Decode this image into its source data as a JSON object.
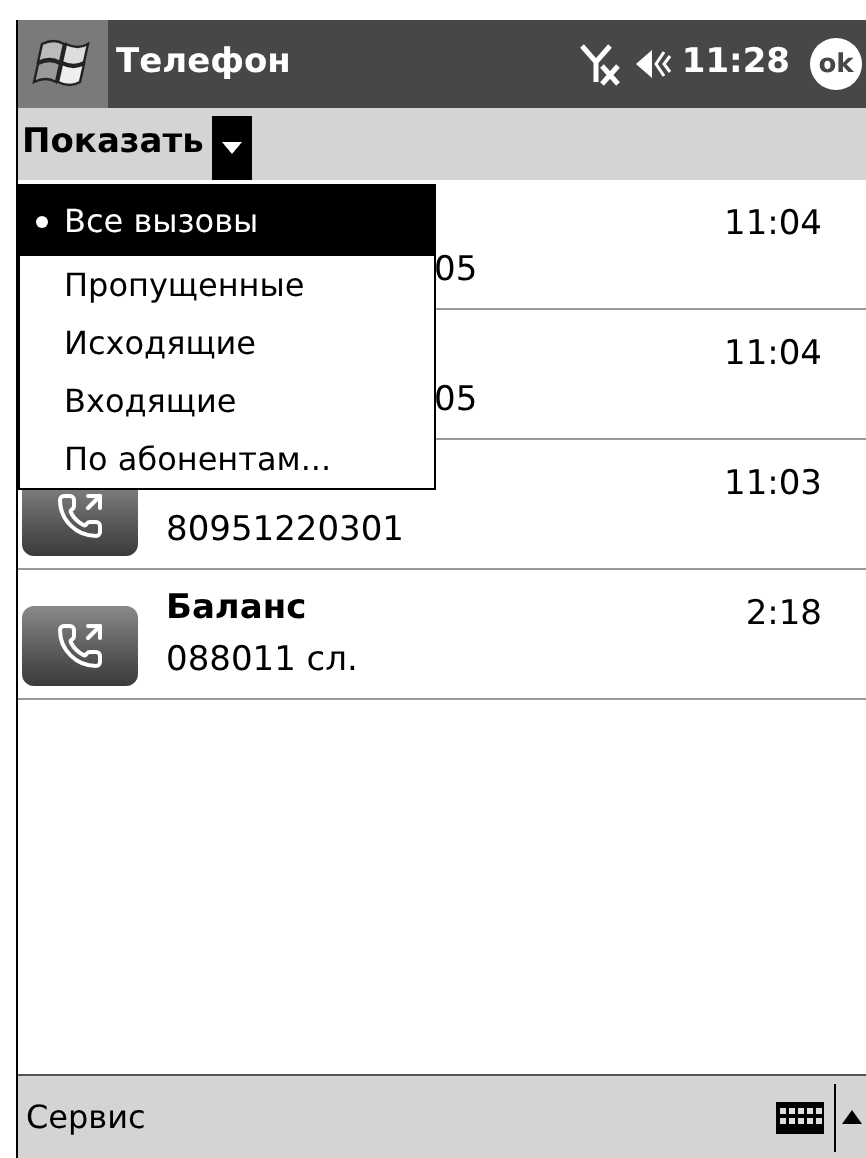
{
  "title_bar": {
    "title": "Телефон",
    "time": "11:28",
    "ok_button": "ok"
  },
  "filter_bar": {
    "label": "Показать"
  },
  "filter_menu": [
    {
      "label": "Все вызовы",
      "selected": true
    },
    {
      "label": "Пропущенные",
      "selected": false
    },
    {
      "label": "Исходящие",
      "selected": false
    },
    {
      "label": "Входящие",
      "selected": false
    },
    {
      "label": "По абонентам...",
      "selected": false
    }
  ],
  "calls": [
    {
      "kind": "covered",
      "number": "05",
      "time": "11:04"
    },
    {
      "kind": "covered",
      "number": "05",
      "time": "11:04"
    },
    {
      "kind": "partial",
      "number": "80951220301",
      "time": "11:03"
    },
    {
      "kind": "full",
      "name": "Баланс",
      "number": "088011 сл.",
      "time": "2:18"
    }
  ],
  "bottom_bar": {
    "menu": "Сервис"
  }
}
